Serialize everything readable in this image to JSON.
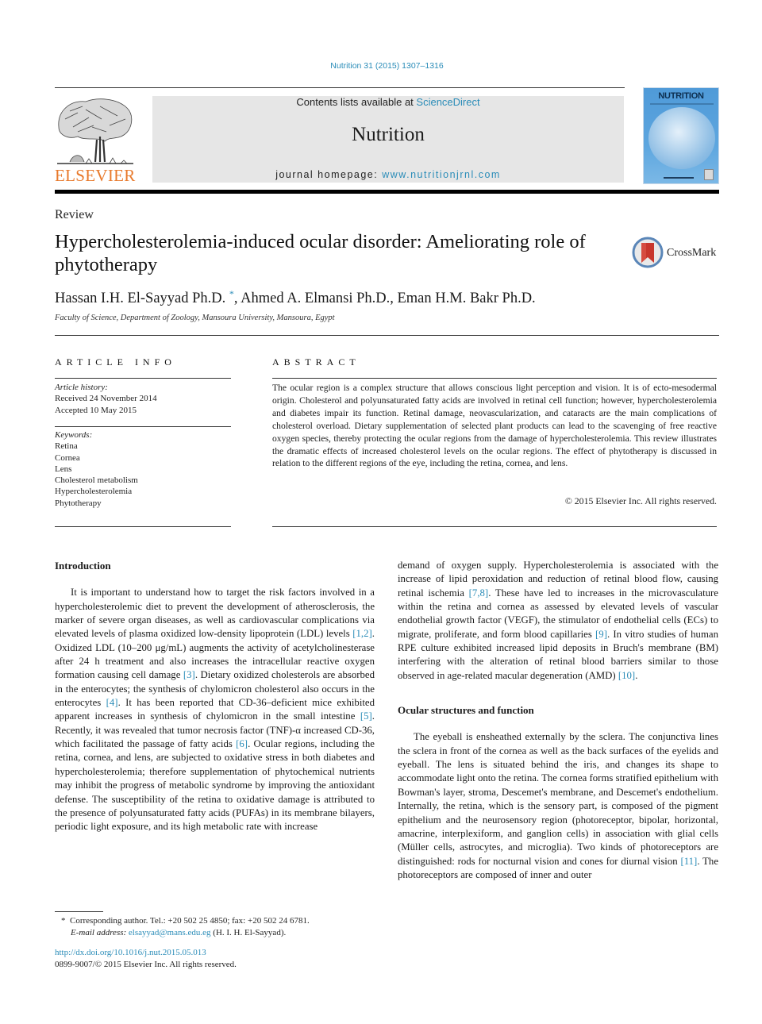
{
  "header": {
    "journal_ref": "Nutrition 31 (2015) 1307–1316",
    "publisher_logo_text": "ELSEVIER",
    "contents_prefix": "Contents lists available at ",
    "contents_link": "ScienceDirect",
    "journal_name": "Nutrition",
    "homepage_prefix": "journal homepage: ",
    "homepage_link": "www.nutritionjrnl.com",
    "cover_title": "NUTRITION",
    "crossmark_label": "CrossMark"
  },
  "colors": {
    "link": "#2a8cb8",
    "elsevier_orange": "#e8792b",
    "header_box": "#e6e6e6",
    "crossmark_red": "#c8372d"
  },
  "article": {
    "type": "Review",
    "title": "Hypercholesterolemia-induced ocular disorder: Ameliorating role of phytotherapy",
    "authors": "Hassan I.H. El-Sayyad Ph.D.",
    "author_marker": "*",
    "authors_rest": ", Ahmed A. Elmansi Ph.D., Eman H.M. Bakr Ph.D.",
    "affiliation": "Faculty of Science, Department of Zoology, Mansoura University, Mansoura, Egypt"
  },
  "article_info": {
    "heading": "ARTICLE INFO",
    "history_label": "Article history:",
    "received": "Received 24 November 2014",
    "accepted": "Accepted 10 May 2015",
    "keywords_label": "Keywords:",
    "keywords": [
      "Retina",
      "Cornea",
      "Lens",
      "Cholesterol metabolism",
      "Hypercholesterolemia",
      "Phytotherapy"
    ]
  },
  "abstract": {
    "heading": "ABSTRACT",
    "text": "The ocular region is a complex structure that allows conscious light perception and vision. It is of ecto-mesodermal origin. Cholesterol and polyunsaturated fatty acids are involved in retinal cell function; however, hypercholesterolemia and diabetes impair its function. Retinal damage, neovascularization, and cataracts are the main complications of cholesterol overload. Dietary supplementation of selected plant products can lead to the scavenging of free reactive oxygen species, thereby protecting the ocular regions from the damage of hypercholesterolemia. This review illustrates the dramatic effects of increased cholesterol levels on the ocular regions. The effect of phytotherapy is discussed in relation to the different regions of the eye, including the retina, cornea, and lens.",
    "copyright": "© 2015 Elsevier Inc. All rights reserved."
  },
  "body": {
    "intro_heading": "Introduction",
    "intro": [
      "It is important to understand how to target the risk factors involved in a hypercholesterolemic diet to prevent the development of atherosclerosis, the marker of severe organ diseases, as well as cardiovascular complications via elevated levels of plasma oxidized low-density lipoprotein (LDL) levels ",
      "[1,2]",
      ". Oxidized LDL (10–200 μg/mL) augments the activity of acetylcholinesterase after 24 h treatment and also increases the intracellular reactive oxygen formation causing cell damage ",
      "[3]",
      ". Dietary oxidized cholesterols are absorbed in the enterocytes; the synthesis of chylomicron cholesterol also occurs in the enterocytes ",
      "[4]",
      ". It has been reported that CD-36–deficient mice exhibited apparent increases in synthesis of chylomicron in the small intestine ",
      "[5]",
      ". Recently, it was revealed that tumor necrosis factor (TNF)-α increased CD-36, which facilitated the passage of fatty acids ",
      "[6]",
      ". Ocular regions, including the retina, cornea, and lens, are subjected to oxidative stress in both diabetes and hypercholesterolemia; therefore supplementation of phytochemical nutrients may inhibit the progress of metabolic syndrome by improving the antioxidant defense. The susceptibility of the retina to oxidative damage is attributed to the presence of polyunsaturated fatty acids (PUFAs) in its membrane bilayers, periodic light exposure, and its high metabolic rate with increase demand of oxygen supply. Hypercholesterolemia is associated with the increase of lipid peroxidation and reduction of retinal blood flow, causing retinal ischemia ",
      "[7,8]",
      ". These have led to increases in the microvasculature within the retina and cornea as assessed by elevated levels of vascular endothelial growth factor (VEGF), the stimulator of endothelial cells (ECs) to migrate, proliferate, and form blood capillaries ",
      "[9]",
      ". In vitro studies of human RPE culture exhibited increased lipid deposits in Bruch's membrane (BM) interfering with the alteration of retinal blood barriers similar to those observed in age-related macular degeneration (AMD) ",
      "[10]",
      "."
    ],
    "ocular_heading": "Ocular structures and function",
    "ocular": [
      "The eyeball is ensheathed externally by the sclera. The conjunctiva lines the sclera in front of the cornea as well as the back surfaces of the eyelids and eyeball. The lens is situated behind the iris, and changes its shape to accommodate light onto the retina. The cornea forms stratified epithelium with Bowman's layer, stroma, Descemet's membrane, and Descemet's endothelium. Internally, the retina, which is the sensory part, is composed of the pigment epithelium and the neurosensory region (photoreceptor, bipolar, horizontal, amacrine, interplexiform, and ganglion cells) in association with glial cells (Müller cells, astrocytes, and microglia). Two kinds of photoreceptors are distinguished: rods for nocturnal vision and cones for diurnal vision ",
      "[11]",
      ". The photoreceptors are composed of inner and outer"
    ]
  },
  "footnotes": {
    "marker": "*",
    "corresponding": "Corresponding author. Tel.: +20 502 25 4850; fax: +20 502 24 6781.",
    "email_label": "E-mail address: ",
    "email": "elsayyad@mans.edu.eg",
    "email_suffix": " (H. I. H. El-Sayyad).",
    "doi": "http://dx.doi.org/10.1016/j.nut.2015.05.013",
    "issn": "0899-9007/© 2015 Elsevier Inc. All rights reserved."
  }
}
